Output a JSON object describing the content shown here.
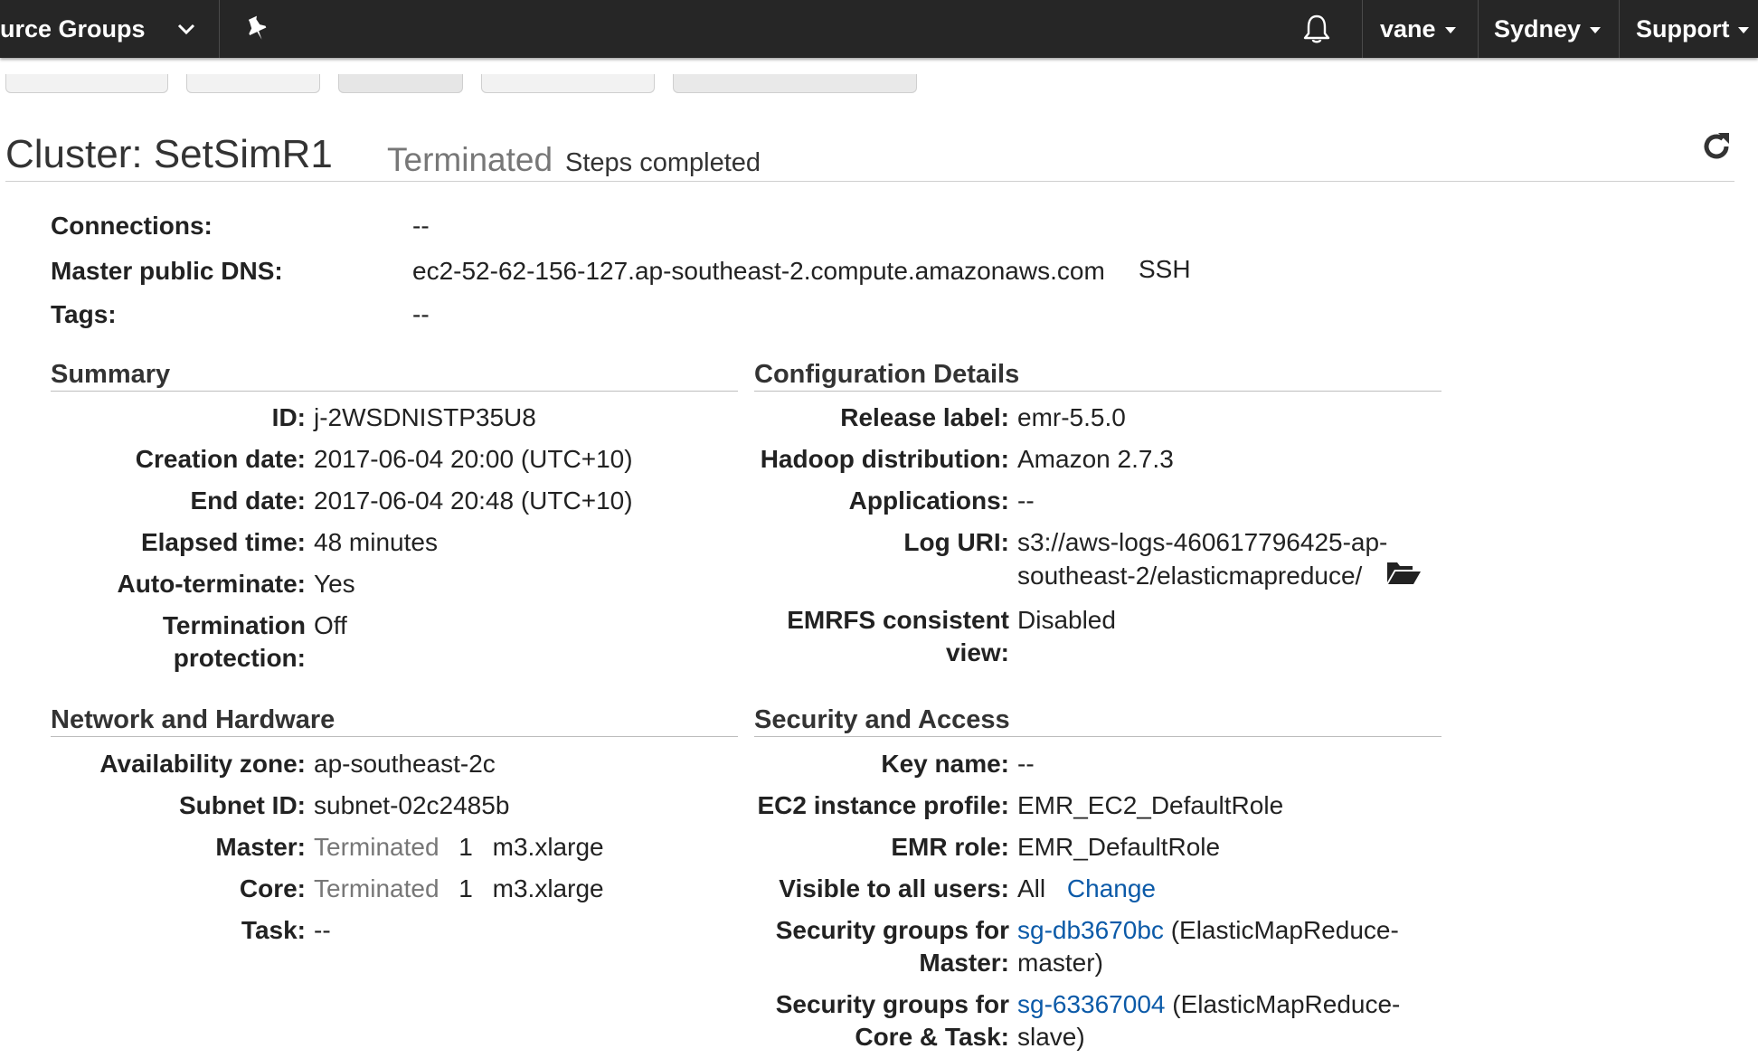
{
  "topbar": {
    "resource_groups": "urce Groups",
    "user": "vane",
    "region": "Sydney",
    "support": "Support"
  },
  "icons": {
    "pin": "pin-icon",
    "bell": "bell-icon",
    "refresh": "refresh-icon",
    "folder": "folder-open-icon"
  },
  "cluster": {
    "title": "Cluster: SetSimR1",
    "status": "Terminated",
    "status_detail": "Steps completed"
  },
  "connections": {
    "connections_label": "Connections:",
    "connections_value": "--",
    "dns_label": "Master public DNS:",
    "dns_value": "ec2-52-62-156-127.ap-southeast-2.compute.amazonaws.com",
    "ssh_link": "SSH",
    "tags_label": "Tags:",
    "tags_value": "--"
  },
  "summary": {
    "title": "Summary",
    "id_label": "ID:",
    "id_value": "j-2WSDNISTP35U8",
    "creation_label": "Creation date:",
    "creation_value": "2017-06-04 20:00 (UTC+10)",
    "end_label": "End date:",
    "end_value": "2017-06-04 20:48 (UTC+10)",
    "elapsed_label": "Elapsed time:",
    "elapsed_value": "48 minutes",
    "autoterm_label": "Auto-terminate:",
    "autoterm_value": "Yes",
    "termprot_label_1": "Termination",
    "termprot_label_2": "protection:",
    "termprot_value": "Off"
  },
  "config": {
    "title": "Configuration Details",
    "release_label": "Release label:",
    "release_value": "emr-5.5.0",
    "hadoop_label": "Hadoop distribution:",
    "hadoop_value": "Amazon 2.7.3",
    "apps_label": "Applications:",
    "apps_value": "--",
    "log_label": "Log URI:",
    "log_value_1": "s3://aws-logs-460617796425-ap-",
    "log_value_2": "southeast-2/elasticmapreduce/",
    "emrfs_label_1": "EMRFS consistent",
    "emrfs_label_2": "view:",
    "emrfs_value": "Disabled"
  },
  "network": {
    "title": "Network and Hardware",
    "az_label": "Availability zone:",
    "az_value": "ap-southeast-2c",
    "subnet_label": "Subnet ID:",
    "subnet_value": "subnet-02c2485b",
    "master_label": "Master:",
    "master_status": "Terminated",
    "master_count": "1",
    "master_type": "m3.xlarge",
    "core_label": "Core:",
    "core_status": "Terminated",
    "core_count": "1",
    "core_type": "m3.xlarge",
    "task_label": "Task:",
    "task_value": "--"
  },
  "security": {
    "title": "Security and Access",
    "key_label": "Key name:",
    "key_value": "--",
    "ec2_label": "EC2 instance profile:",
    "ec2_value": "EMR_EC2_DefaultRole",
    "role_label": "EMR role:",
    "role_value": "EMR_DefaultRole",
    "visible_label": "Visible to all users:",
    "visible_value": "All",
    "change_link": "Change",
    "sgm_label_1": "Security groups for",
    "sgm_label_2": "Master:",
    "sgm_link": "sg-db3670bc",
    "sgm_desc_1": "(ElasticMapReduce-",
    "sgm_desc_2": "master)",
    "sgc_label_1": "Security groups for",
    "sgc_label_2": "Core & Task:",
    "sgc_link": "sg-63367004",
    "sgc_desc_1": "(ElasticMapReduce-",
    "sgc_desc_2": "slave)"
  }
}
